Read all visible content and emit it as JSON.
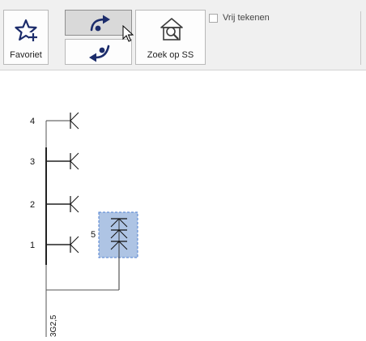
{
  "toolbar": {
    "favoriet_label": "Favoriet",
    "zoek_label": "Zoek op SS",
    "vrij_tekenen_label": "Vrij tekenen",
    "vrij_tekenen_checked": false
  },
  "diagram": {
    "circuits": [
      {
        "number": "4"
      },
      {
        "number": "3"
      },
      {
        "number": "2"
      },
      {
        "number": "1"
      },
      {
        "number": "5"
      }
    ],
    "cable_label": "3G2,5",
    "selection_color": "#aec4e4"
  }
}
